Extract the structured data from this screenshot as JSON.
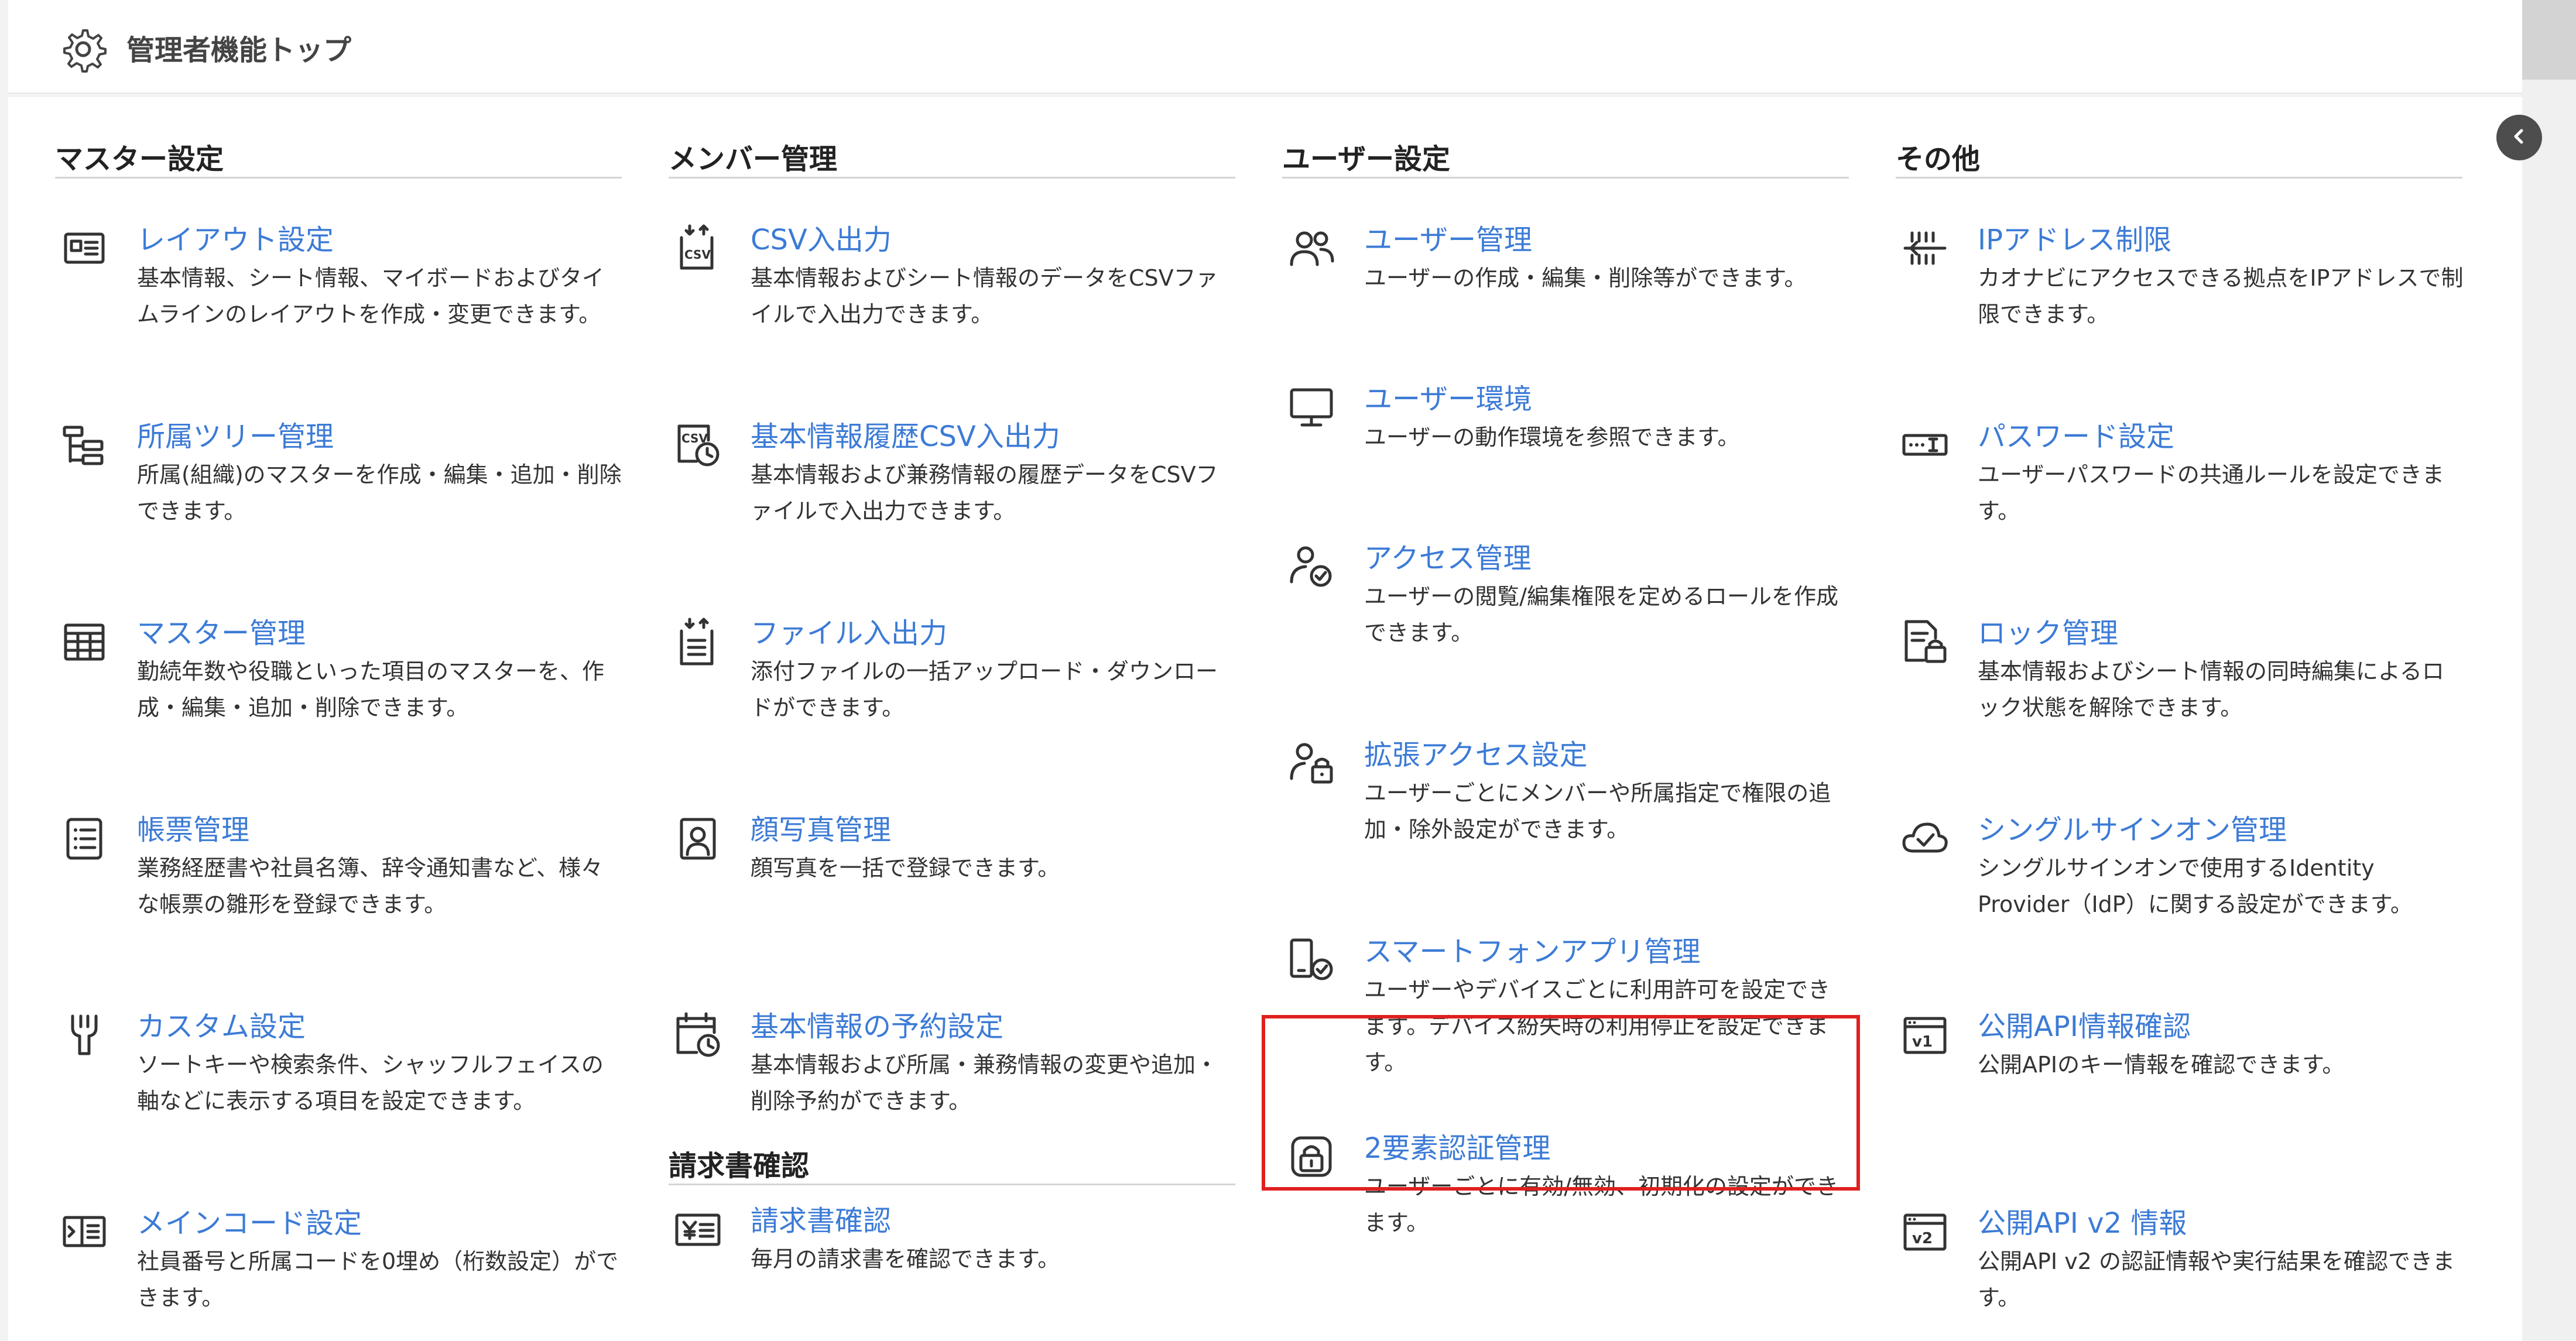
{
  "header": {
    "title": "管理者機能トップ"
  },
  "columns": [
    {
      "heading": "マスター設定",
      "items": [
        {
          "icon": "layout-card-icon",
          "title": "レイアウト設定",
          "desc": "基本情報、シート情報、マイボードおよびタイムラインのレイアウトを作成・変更できます。"
        },
        {
          "icon": "org-tree-icon",
          "title": "所属ツリー管理",
          "desc": "所属(組織)のマスターを作成・編集・追加・削除できます。"
        },
        {
          "icon": "table-grid-icon",
          "title": "マスター管理",
          "desc": "勤続年数や役職といった項目のマスターを、作成・編集・追加・削除できます。"
        },
        {
          "icon": "list-document-icon",
          "title": "帳票管理",
          "desc": "業務経歴書や社員名簿、辞令通知書など、様々な帳票の雛形を登録できます。"
        },
        {
          "icon": "wrench-icon",
          "title": "カスタム設定",
          "desc": "ソートキーや検索条件、シャッフルフェイスの軸などに表示する項目を設定できます。"
        },
        {
          "icon": "main-code-icon",
          "title": "メインコード設定",
          "desc": "社員番号と所属コードを0埋め（桁数設定）ができます。"
        }
      ]
    },
    {
      "heading": "メンバー管理",
      "items": [
        {
          "icon": "csv-transfer-icon",
          "title": "CSV入出力",
          "desc": "基本情報およびシート情報のデータをCSVファイルで入出力できます。"
        },
        {
          "icon": "csv-history-icon",
          "title": "基本情報履歴CSV入出力",
          "desc": "基本情報および兼務情報の履歴データをCSVファイルで入出力できます。"
        },
        {
          "icon": "file-transfer-icon",
          "title": "ファイル入出力",
          "desc": "添付ファイルの一括アップロード・ダウンロードができます。"
        },
        {
          "icon": "portrait-icon",
          "title": "顔写真管理",
          "desc": "顔写真を一括で登録できます。"
        },
        {
          "icon": "calendar-clock-icon",
          "title": "基本情報の予約設定",
          "desc": "基本情報および所属・兼務情報の変更や追加・削除予約ができます。"
        }
      ],
      "section2": {
        "heading": "請求書確認",
        "items": [
          {
            "icon": "yen-invoice-icon",
            "title": "請求書確認",
            "desc": "毎月の請求書を確認できます。"
          }
        ]
      }
    },
    {
      "heading": "ユーザー設定",
      "items": [
        {
          "icon": "users-icon",
          "title": "ユーザー管理",
          "desc": "ユーザーの作成・編集・削除等ができます。"
        },
        {
          "icon": "monitor-icon",
          "title": "ユーザー環境",
          "desc": "ユーザーの動作環境を参照できます。"
        },
        {
          "icon": "user-check-icon",
          "title": "アクセス管理",
          "desc": "ユーザーの閲覧/編集権限を定めるロールを作成できます。"
        },
        {
          "icon": "user-lock-icon",
          "title": "拡張アクセス設定",
          "desc": "ユーザーごとにメンバーや所属指定で権限の追加・除外設定ができます。"
        },
        {
          "icon": "phone-check-icon",
          "title": "スマートフォンアプリ管理",
          "desc": "ユーザーやデバイスごとに利用許可を設定できます。デバイス紛失時の利用停止を設定できます。"
        },
        {
          "icon": "two-factor-lock-icon",
          "title": "2要素認証管理",
          "desc": "ユーザーごとに有効/無効、初期化の設定ができます。"
        }
      ]
    },
    {
      "heading": "その他",
      "items": [
        {
          "icon": "ip-restrict-icon",
          "title": "IPアドレス制限",
          "desc": "カオナビにアクセスできる拠点をIPアドレスで制限できます。"
        },
        {
          "icon": "password-field-icon",
          "title": "パスワード設定",
          "desc": "ユーザーパスワードの共通ルールを設定できます。"
        },
        {
          "icon": "document-lock-icon",
          "title": "ロック管理",
          "desc": "基本情報およびシート情報の同時編集によるロック状態を解除できます。"
        },
        {
          "icon": "cloud-check-icon",
          "title": "シングルサインオン管理",
          "desc": "シングルサインオンで使用するIdentity Provider（IdP）に関する設定ができます。"
        },
        {
          "icon": "api-v1-icon",
          "title": "公開API情報確認",
          "desc": "公開APIのキー情報を確認できます。"
        },
        {
          "icon": "api-v2-icon",
          "title": "公開API v2 情報",
          "desc": "公開API v2 の認証情報や実行結果を確認できます。"
        }
      ]
    }
  ],
  "highlighted_item": "2要素認証管理",
  "colors": {
    "link": "#3c7bd6",
    "highlight": "#e02020",
    "collapse_button": "#4d4d4d"
  }
}
